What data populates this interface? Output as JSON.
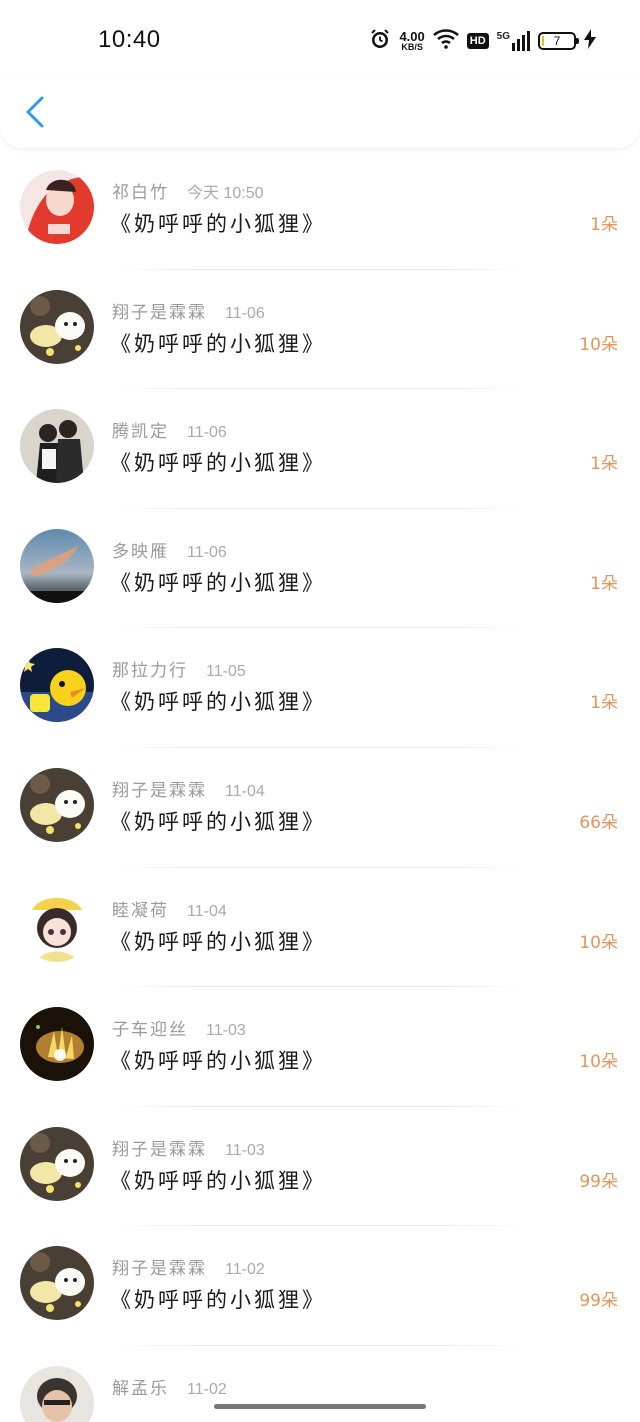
{
  "status_bar": {
    "time": "10:40",
    "speed_value": "4.00",
    "speed_unit": "KB/S",
    "hd_label": "HD",
    "network_label": "5G",
    "battery_level": "7"
  },
  "nav": {
    "back_icon": "chevron-left-icon",
    "accent": "#2a9bf0"
  },
  "list": {
    "items": [
      {
        "user": "祁白竹",
        "date": "今天 10:50",
        "gift": "《奶呼呼的小狐狸》",
        "count": "1朵",
        "avatar": "avatar-red"
      },
      {
        "user": "翔子是霖霖",
        "date": "11-06",
        "gift": "《奶呼呼的小狐狸》",
        "count": "10朵",
        "avatar": "avatar-bear"
      },
      {
        "user": "腾凯定",
        "date": "11-06",
        "gift": "《奶呼呼的小狐狸》",
        "count": "1朵",
        "avatar": "avatar-couple"
      },
      {
        "user": "多映雁",
        "date": "11-06",
        "gift": "《奶呼呼的小狐狸》",
        "count": "1朵",
        "avatar": "avatar-sky"
      },
      {
        "user": "那拉力行",
        "date": "11-05",
        "gift": "《奶呼呼的小狐狸》",
        "count": "1朵",
        "avatar": "avatar-duck"
      },
      {
        "user": "翔子是霖霖",
        "date": "11-04",
        "gift": "《奶呼呼的小狐狸》",
        "count": "66朵",
        "avatar": "avatar-bear"
      },
      {
        "user": "睦凝荷",
        "date": "11-04",
        "gift": "《奶呼呼的小狐狸》",
        "count": "10朵",
        "avatar": "avatar-girl"
      },
      {
        "user": "子车迎丝",
        "date": "11-03",
        "gift": "《奶呼呼的小狐狸》",
        "count": "10朵",
        "avatar": "avatar-light"
      },
      {
        "user": "翔子是霖霖",
        "date": "11-03",
        "gift": "《奶呼呼的小狐狸》",
        "count": "99朵",
        "avatar": "avatar-bear"
      },
      {
        "user": "翔子是霖霖",
        "date": "11-02",
        "gift": "《奶呼呼的小狐狸》",
        "count": "99朵",
        "avatar": "avatar-bear"
      },
      {
        "user": "解孟乐",
        "date": "11-02",
        "gift": "",
        "count": "",
        "avatar": "avatar-man"
      }
    ]
  },
  "colors": {
    "count": "#e8935a",
    "name": "#9a9a9a",
    "date": "#aaaaaa"
  }
}
